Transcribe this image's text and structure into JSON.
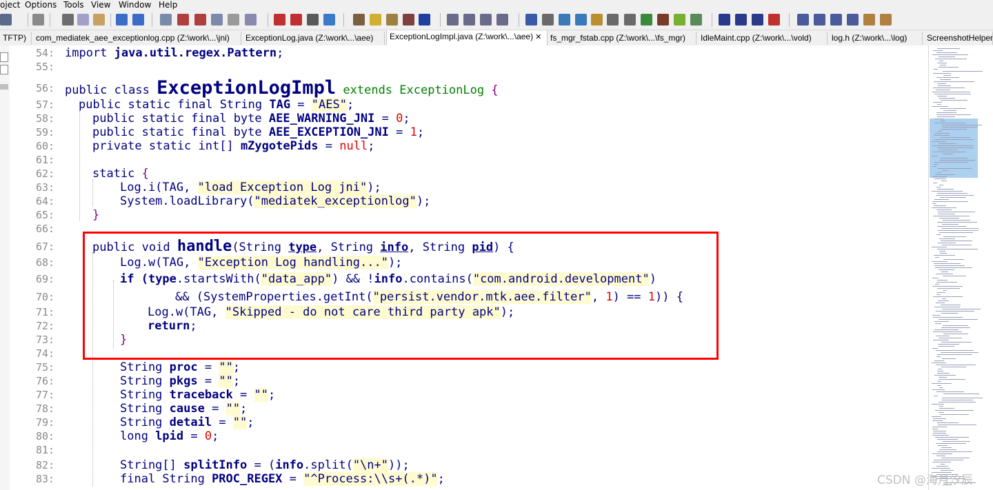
{
  "menu": [
    "oject",
    "Options",
    "Tools",
    "View",
    "Window",
    "Help"
  ],
  "tabs": [
    {
      "label": "TFTP)",
      "active": false
    },
    {
      "label": "com_mediatek_aee_exceptionlog.cpp (Z:\\work\\...\\jni)",
      "active": false
    },
    {
      "label": "ExceptionLog.java (Z:\\work\\...\\aee)",
      "active": false
    },
    {
      "label": "ExceptionLogImpl.java (Z:\\work\\...\\aee)",
      "active": true,
      "close": "✕"
    },
    {
      "label": "fs_mgr_fstab.cpp (Z:\\work\\...\\fs_mgr)",
      "active": false
    },
    {
      "label": "IdleMaint.cpp (Z:\\work\\...\\vold)",
      "active": false
    },
    {
      "label": "log.h (Z:\\work\\...\\log)",
      "active": false
    },
    {
      "label": "ScreenshotHelper",
      "active": false
    }
  ],
  "code": {
    "l54": {
      "n": "54:",
      "t1": "import ",
      "t2": "java.util.regex.Pattern",
      "t3": ";"
    },
    "l55": {
      "n": "55:"
    },
    "l56": {
      "n": "56:",
      "t1": "public class ",
      "t2": "ExceptionLogImpl",
      "t3": " extends ExceptionLog ",
      "t4": "{"
    },
    "l57": {
      "n": "57:",
      "t1": "public static final String ",
      "t2": "TAG",
      "t3": " = ",
      "s1": "\"AES\"",
      "t4": ";"
    },
    "l58": {
      "n": "58:",
      "t1": "public static final byte ",
      "t2": "AEE_WARNING_JNI",
      "t3": " = ",
      "v1": "0",
      "t4": ";"
    },
    "l59": {
      "n": "59:",
      "t1": "public static final byte ",
      "t2": "AEE_EXCEPTION_JNI",
      "t3": " = ",
      "v1": "1",
      "t4": ";"
    },
    "l60": {
      "n": "60:",
      "t1": "private static int[] ",
      "t2": "mZygotePids",
      "t3": " = ",
      "v1": "null",
      "t4": ";"
    },
    "l61": {
      "n": "61:"
    },
    "l62": {
      "n": "62:",
      "t1": "static ",
      "t2": "{"
    },
    "l63": {
      "n": "63:",
      "t1": "Log.i(TAG, ",
      "s1": "\"load Exception Log jni\"",
      "t2": ");"
    },
    "l64": {
      "n": "64:",
      "t1": "System.loadLibrary(",
      "s1": "\"mediatek_exceptionlog\"",
      "t2": ");"
    },
    "l65": {
      "n": "65:",
      "t1": "}"
    },
    "l66": {
      "n": "66:"
    },
    "l67": {
      "n": "67:",
      "t1": "public void ",
      "t2": "handle",
      "t3": "(String ",
      "t4": "type",
      "t5": ", String ",
      "t6": "info",
      "t7": ", String ",
      "t8": "pid",
      "t9": ") {"
    },
    "l68": {
      "n": "68:",
      "t1": "Log.w(TAG, ",
      "s1": "\"Exception Log handling...\"",
      "t2": ");"
    },
    "l69": {
      "n": "69:",
      "t1": "if (",
      "t2": "type",
      "t3": ".startsWith(",
      "s1": "\"data_app\"",
      "t4": ") && !",
      "t5": "info",
      "t6": ".contains(",
      "s2": "\"com.android.development\"",
      "t7": ")"
    },
    "l70": {
      "n": "70:",
      "t1": "&& (SystemProperties.getInt(",
      "s1": "\"persist.vendor.mtk.aee.filter\"",
      "t2": ", ",
      "v1": "1",
      "t3": ") == ",
      "v2": "1",
      "t4": ")) {"
    },
    "l71": {
      "n": "71:",
      "t1": "Log.w(TAG, ",
      "s1": "\"Skipped - do not care third party apk\"",
      "t2": ");"
    },
    "l72": {
      "n": "72:",
      "t1": "return",
      "t2": ";"
    },
    "l73": {
      "n": "73:",
      "t1": "}"
    },
    "l74": {
      "n": "74:"
    },
    "l75": {
      "n": "75:",
      "t1": "String ",
      "t2": "proc",
      "t3": " = ",
      "s1": "\"\"",
      "t4": ";"
    },
    "l76": {
      "n": "76:",
      "t1": "String ",
      "t2": "pkgs",
      "t3": " = ",
      "s1": "\"\"",
      "t4": ";"
    },
    "l77": {
      "n": "77:",
      "t1": "String ",
      "t2": "traceback",
      "t3": " = ",
      "s1": "\"\"",
      "t4": ";"
    },
    "l78": {
      "n": "78:",
      "t1": "String ",
      "t2": "cause",
      "t3": " = ",
      "s1": "\"\"",
      "t4": ";"
    },
    "l79": {
      "n": "79:",
      "t1": "String ",
      "t2": "detail",
      "t3": " = ",
      "s1": "\"\"",
      "t4": ";"
    },
    "l80": {
      "n": "80:",
      "t1": "long ",
      "t2": "lpid",
      "t3": " = ",
      "v1": "0",
      "t4": ";"
    },
    "l81": {
      "n": "81:"
    },
    "l82": {
      "n": "82:",
      "t1": "String[] ",
      "t2": "splitInfo",
      "t3": " = (",
      "t4": "info",
      "t5": ".split(",
      "s1": "\"\\n+\"",
      "t6": "));"
    },
    "l83": {
      "n": "83:",
      "t1": "final String ",
      "t2": "PROC_REGEX",
      "t3": " = ",
      "s1": "\"^Process:\\\\s+(.*)\"",
      "t4": ";"
    }
  },
  "watermark": "CSDN @海月汐辰",
  "colors": {
    "highlight_box": "#ff0000",
    "string_bg": "#fffbd0",
    "number": "#e00000",
    "keyword": "#000080"
  }
}
